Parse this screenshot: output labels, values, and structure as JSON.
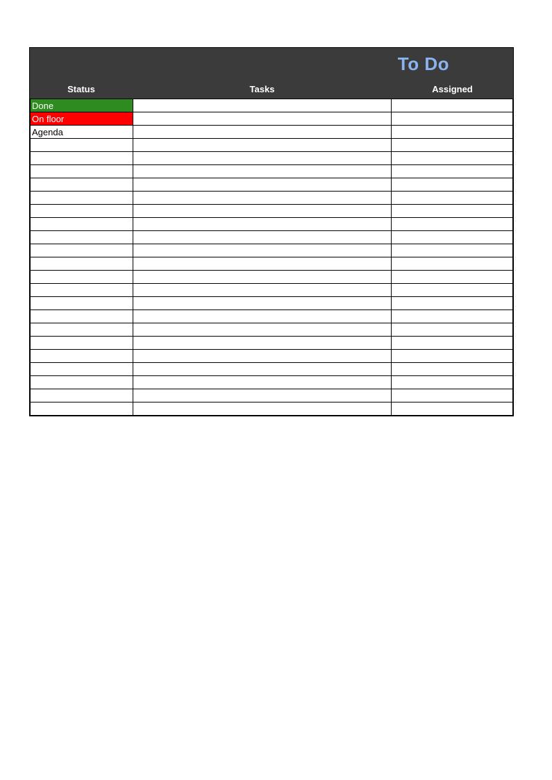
{
  "title": "To Do",
  "columns": {
    "status": "Status",
    "tasks": "Tasks",
    "assigned": "Assigned"
  },
  "status_styles": {
    "Done": "status-done",
    "On floor": "status-on-floor",
    "Agenda": "status-agenda"
  },
  "rows": [
    {
      "status": "Done",
      "tasks": "",
      "assigned": ""
    },
    {
      "status": "On floor",
      "tasks": "",
      "assigned": ""
    },
    {
      "status": "Agenda",
      "tasks": "",
      "assigned": ""
    },
    {
      "status": "",
      "tasks": "",
      "assigned": ""
    },
    {
      "status": "",
      "tasks": "",
      "assigned": ""
    },
    {
      "status": "",
      "tasks": "",
      "assigned": ""
    },
    {
      "status": "",
      "tasks": "",
      "assigned": ""
    },
    {
      "status": "",
      "tasks": "",
      "assigned": ""
    },
    {
      "status": "",
      "tasks": "",
      "assigned": ""
    },
    {
      "status": "",
      "tasks": "",
      "assigned": ""
    },
    {
      "status": "",
      "tasks": "",
      "assigned": ""
    },
    {
      "status": "",
      "tasks": "",
      "assigned": ""
    },
    {
      "status": "",
      "tasks": "",
      "assigned": ""
    },
    {
      "status": "",
      "tasks": "",
      "assigned": ""
    },
    {
      "status": "",
      "tasks": "",
      "assigned": ""
    },
    {
      "status": "",
      "tasks": "",
      "assigned": ""
    },
    {
      "status": "",
      "tasks": "",
      "assigned": ""
    },
    {
      "status": "",
      "tasks": "",
      "assigned": ""
    },
    {
      "status": "",
      "tasks": "",
      "assigned": ""
    },
    {
      "status": "",
      "tasks": "",
      "assigned": ""
    },
    {
      "status": "",
      "tasks": "",
      "assigned": ""
    },
    {
      "status": "",
      "tasks": "",
      "assigned": ""
    },
    {
      "status": "",
      "tasks": "",
      "assigned": ""
    },
    {
      "status": "",
      "tasks": "",
      "assigned": ""
    }
  ]
}
